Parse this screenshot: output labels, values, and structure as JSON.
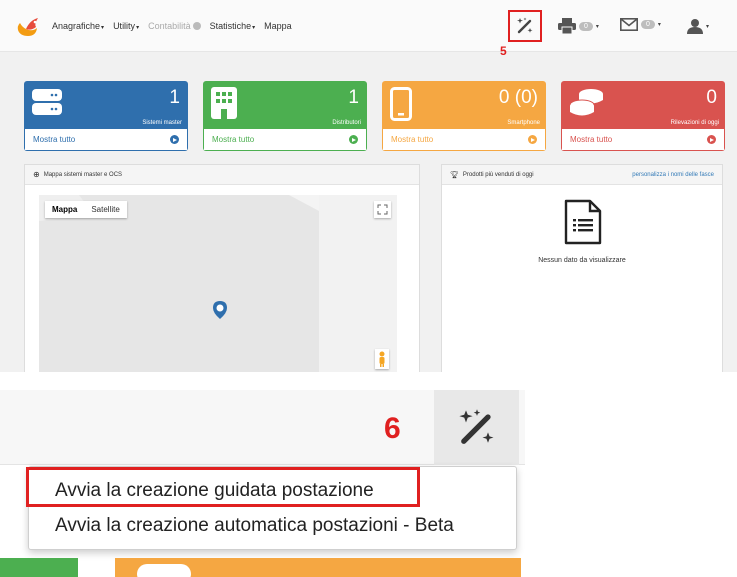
{
  "nav": {
    "items": [
      {
        "label": "Anagrafiche",
        "caret": "▾",
        "disabled": false
      },
      {
        "label": "Utility",
        "caret": "▾",
        "disabled": false
      },
      {
        "label": "Contabilità",
        "caret": "",
        "disabled": true
      },
      {
        "label": "Statistiche",
        "caret": "▾",
        "disabled": false
      },
      {
        "label": "Mappa",
        "caret": "",
        "disabled": false
      }
    ],
    "printer_count": "0",
    "mail_count": "0",
    "icons": [
      "magic-wand-icon",
      "printer-icon",
      "envelope-icon",
      "user-icon"
    ]
  },
  "annotations": {
    "top": "5",
    "bottom": "6"
  },
  "tiles": [
    {
      "count": "1",
      "label": "Sistemi master",
      "footer": "Mostra tutto",
      "color": "#2f6fad",
      "icon": "server-icon"
    },
    {
      "count": "1",
      "label": "Distributori",
      "footer": "Mostra tutto",
      "color": "#4caf50",
      "icon": "building-icon"
    },
    {
      "count": "0 (0)",
      "label": "Smartphone",
      "footer": "Mostra tutto",
      "color": "#f5a742",
      "icon": "smartphone-icon"
    },
    {
      "count": "0",
      "label": "Rilevazioni di oggi",
      "footer": "Mostra tutto",
      "color": "#d9534f",
      "icon": "coins-icon"
    }
  ],
  "map_panel": {
    "title": "Mappa sistemi master e OCS",
    "tabs": [
      "Mappa",
      "Satellite"
    ]
  },
  "products_panel": {
    "title": "Prodotti più venduti di oggi",
    "link": "personalizza i nomi delle fasce",
    "empty": "Nessun dato da visualizzare"
  },
  "dropdown": {
    "items": [
      "Avvia la creazione guidata postazione",
      "Avvia la creazione automatica postazioni - Beta"
    ]
  },
  "colors": {
    "annotation_red": "#e02020",
    "link_blue": "#337ab7"
  }
}
